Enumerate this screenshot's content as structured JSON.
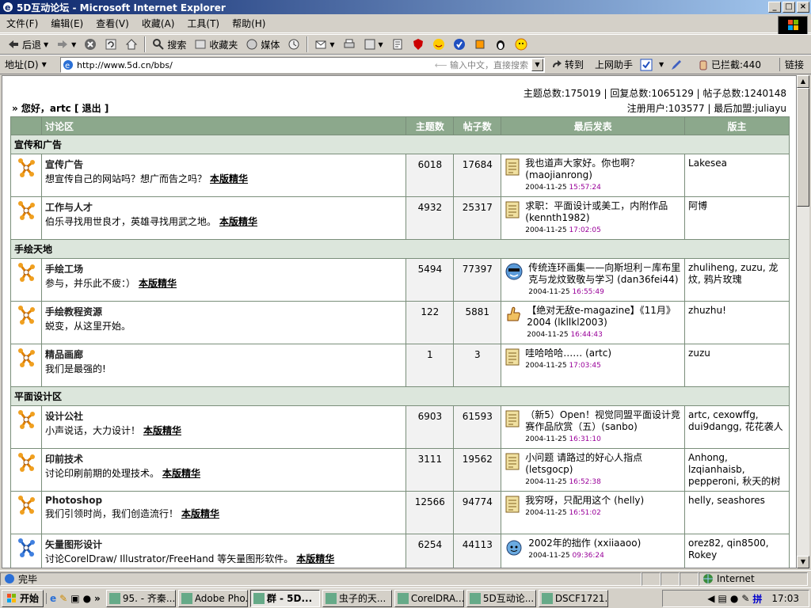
{
  "window": {
    "title": "5D互动论坛 - Microsoft Internet Explorer",
    "min": "_",
    "max": "□",
    "close": "×"
  },
  "menu": [
    "文件(F)",
    "编辑(E)",
    "查看(V)",
    "收藏(A)",
    "工具(T)",
    "帮助(H)"
  ],
  "toolbar": {
    "back": "后退",
    "search": "搜索",
    "favorites": "收藏夹",
    "media": "媒体"
  },
  "address": {
    "label": "地址(D)",
    "url": "http://www.5d.cn/bbs/",
    "hint": "输入中文，直接搜索",
    "go": "转到",
    "helper": "上网助手",
    "blocked": "已拦截:440",
    "links": "链接"
  },
  "stats": {
    "line1": "主题总数:175019 | 回复总数:1065129 | 帖子总数:1240148",
    "line2": "注册用户:103577 | 最后加盟:juliayu"
  },
  "greeting": "» 您好，artc [ 退出 ]",
  "table": {
    "headers": [
      "讨论区",
      "主题数",
      "帖子数",
      "最后发表",
      "版主"
    ],
    "essence": "本版精华",
    "categories": [
      {
        "name": "宣传和广告",
        "forums": [
          {
            "title": "宣传广告",
            "desc": "想宣传自己的网站吗？想广而告之吗？",
            "essence": true,
            "topics": "6018",
            "posts": "17684",
            "last": "我也道声大家好。你也啊？(maojianrong)",
            "date": "2004-11-25",
            "time": "15:57:24",
            "icon": "note",
            "mod": "Lakesea"
          },
          {
            "title": "工作与人才",
            "desc": "伯乐寻找用世良才，英雄寻找用武之地。",
            "essence": true,
            "topics": "4932",
            "posts": "25317",
            "last": "求职：平面设计或美工，内附作品(kennth1982)",
            "date": "2004-11-25",
            "time": "17:02:05",
            "icon": "note",
            "mod": "阿博"
          }
        ]
      },
      {
        "name": "手绘天地",
        "forums": [
          {
            "title": "手绘工场",
            "desc": "参与，并乐此不疲：）",
            "essence": true,
            "topics": "5494",
            "posts": "77397",
            "last": "传统连环画集——向斯坦利－库布里克与龙炆致敬与学习 (dan36fei44)",
            "date": "2004-11-25",
            "time": "16:55:49",
            "icon": "face-cool",
            "mod": "zhuliheng, zuzu, 龙炆, 鸦片玫瑰"
          },
          {
            "title": "手绘教程资源",
            "desc": "蜕变，从这里开始。",
            "essence": false,
            "topics": "122",
            "posts": "5881",
            "last": "【绝对无敌e-magazine】《11月》2004 (lkllkl2003)",
            "date": "2004-11-25",
            "time": "16:44:43",
            "icon": "thumb",
            "mod": "zhuzhu!"
          },
          {
            "title": "精品画廊",
            "desc": "我们是最强的!",
            "essence": false,
            "topics": "1",
            "posts": "3",
            "last": "哇哈哈哈…… (artc)",
            "date": "2004-11-25",
            "time": "17:03:45",
            "icon": "note",
            "mod": "zuzu"
          }
        ]
      },
      {
        "name": "平面设计区",
        "forums": [
          {
            "title": "设计公社",
            "desc": "小声说话，大力设计！",
            "essence": true,
            "topics": "6903",
            "posts": "61593",
            "last": "（新5）Open！视觉同盟平面设计竞赛作品欣赏（五）(sanbo)",
            "date": "2004-11-25",
            "time": "16:31:10",
            "icon": "note",
            "mod": "artc, cexowffg, dui9dangg, 花花袭人"
          },
          {
            "title": "印前技术",
            "desc": "讨论印刷前期的处理技术。",
            "essence": true,
            "topics": "3111",
            "posts": "19562",
            "last": "小问题 请路过的好心人指点 (letsgocp)",
            "date": "2004-11-25",
            "time": "16:52:38",
            "icon": "note",
            "mod": "Anhong, lzqianhaisb, pepperoni, 秋天的树"
          },
          {
            "title": "Photoshop",
            "desc": "我们引领时尚，我们创造流行！",
            "essence": true,
            "topics": "12566",
            "posts": "94774",
            "last": "我穷呀，只配用这个 (helly)",
            "date": "2004-11-25",
            "time": "16:51:02",
            "icon": "note",
            "mod": "helly, seashores"
          },
          {
            "title": "矢量图形设计",
            "desc": "讨论CorelDraw/ Illustrator/FreeHand 等矢量图形软件。",
            "essence": true,
            "topics": "6254",
            "posts": "44113",
            "last": "2002年的拙作 (xxiiaaoo)",
            "date": "2004-11-25",
            "time": "09:36:24",
            "icon": "face-blue",
            "mod": "orez82, qin8500, Rokey"
          }
        ]
      }
    ]
  },
  "status": {
    "text": "完毕",
    "zone": "Internet"
  },
  "taskbar": {
    "start": "开始",
    "tasks": [
      "95. - 齐秦...",
      "Adobe Pho...",
      "群 - 5D...",
      "虫子的天...",
      "CorelDRA...",
      "5D互动论...",
      "DSCF1721..."
    ],
    "active": 2,
    "clock": "17:03"
  }
}
